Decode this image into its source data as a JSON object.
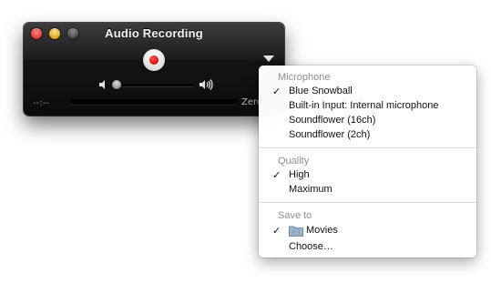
{
  "window": {
    "title": "Audio Recording",
    "timecode": "--:--",
    "size_text": "Zero"
  },
  "volume": {
    "level": 0.0
  },
  "icons": {
    "close": "close-icon",
    "minimize": "minimize-icon",
    "zoom": "zoom-icon",
    "record": "record-icon",
    "menu": "triangle-down-icon",
    "volume_low": "speaker-low-icon",
    "volume_high": "speaker-high-icon",
    "folder": "folder-icon"
  },
  "colors": {
    "record": "#e00000",
    "window_bg": "#141414",
    "menu_bg": "#ffffff",
    "header_text": "#8f8f8f"
  },
  "menu": {
    "microphone": {
      "header": "Microphone",
      "items": [
        {
          "label": "Blue Snowball",
          "checked": "✓"
        },
        {
          "label": "Built-in Input: Internal microphone",
          "checked": ""
        },
        {
          "label": "Soundflower (16ch)",
          "checked": ""
        },
        {
          "label": "Soundflower (2ch)",
          "checked": ""
        }
      ]
    },
    "quality": {
      "header": "Quality",
      "items": [
        {
          "label": "High",
          "checked": "✓"
        },
        {
          "label": "Maximum",
          "checked": ""
        }
      ]
    },
    "save_to": {
      "header": "Save to",
      "items": [
        {
          "label": "Movies",
          "checked": "✓"
        },
        {
          "label": "Choose…",
          "checked": ""
        }
      ]
    }
  }
}
